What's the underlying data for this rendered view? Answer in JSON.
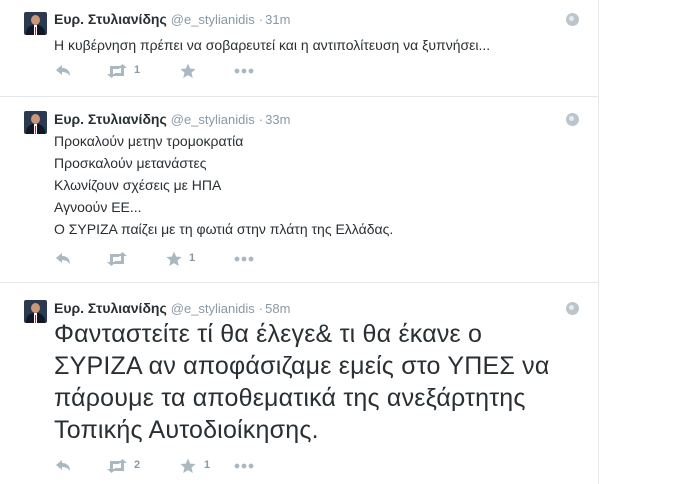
{
  "tweets": [
    {
      "name": "Ευρ. Στυλιανίδης",
      "handle": "@e_stylianidis",
      "separator": "·",
      "time": "31m",
      "text_lines": [
        "Η κυβέρνηση πρέπει να σοβαρευτεί και η αντιπολίτευση να ξυπνήσει..."
      ],
      "retweets": "1",
      "favorites": ""
    },
    {
      "name": "Ευρ. Στυλιανίδης",
      "handle": "@e_stylianidis",
      "separator": "·",
      "time": "33m",
      "text_lines": [
        "Προκαλούν μετην τρομοκρατία",
        "Προσκαλούν μετανάστες",
        "Κλωνίζουν σχέσεις με ΗΠΑ",
        "Αγνοούν ΕΕ...",
        "Ο ΣΥΡΙΖΑ παίζει με τη φωτιά στην πλάτη της Ελλάδας."
      ],
      "retweets": "",
      "favorites": "1"
    },
    {
      "name": "Ευρ. Στυλιανίδης",
      "handle": "@e_stylianidis",
      "separator": "·",
      "time": "58m",
      "text_lines": [
        "Φανταστείτε τί θα έλεγε& τι θα έκανε ο",
        "ΣΥΡΙΖΑ αν αποφάσιζαμε εμείς στο ΥΠΕΣ να",
        "πάρουμε τα αποθεματικά της ανεξάρτητης",
        "Τοπικής Αυτοδιοίκησης."
      ],
      "retweets": "2",
      "favorites": "1"
    }
  ],
  "icons": {
    "reply": "reply-icon",
    "retweet": "retweet-icon",
    "favorite": "star-icon",
    "more": "more-icon",
    "geo": "globe-icon"
  },
  "colors": {
    "action_icon": "#aab8c2",
    "muted_text": "#8899a6",
    "divider": "#e1e8ed"
  }
}
